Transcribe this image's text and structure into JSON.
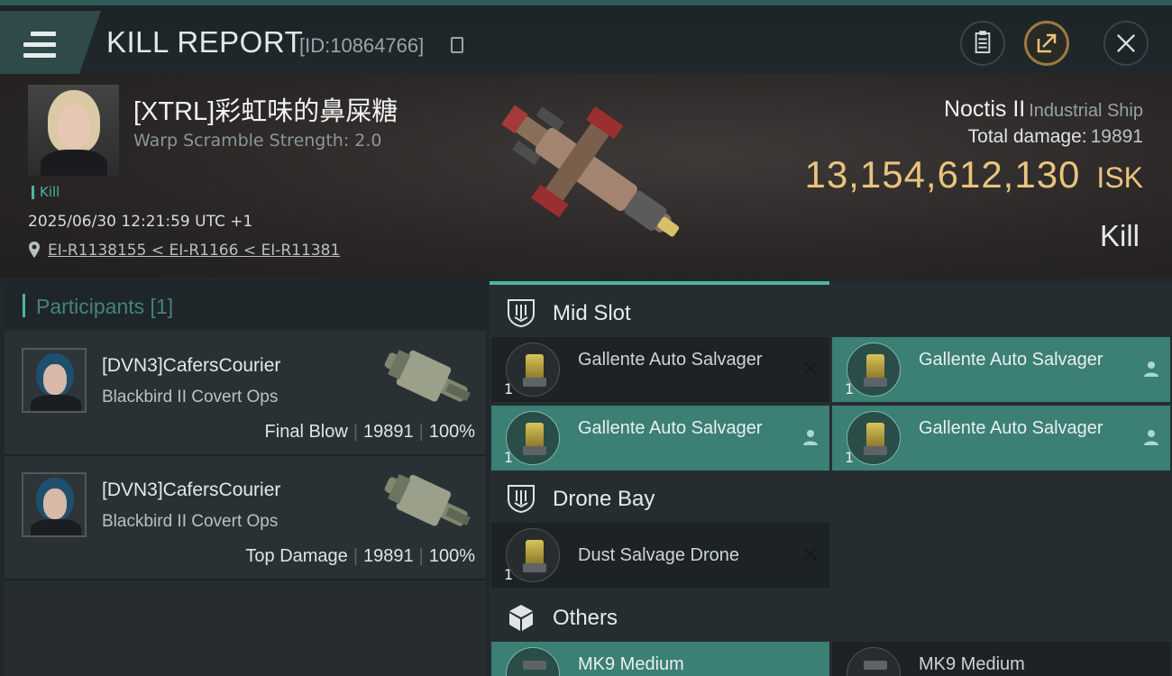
{
  "header": {
    "title": "KILL REPORT",
    "report_id": "[ID:10864766]"
  },
  "victim": {
    "name": "[XTRL]彩虹味的鼻屎糖",
    "warp_scramble": "Warp Scramble Strength: 2.0",
    "kill_tag": "Kill",
    "datetime": "2025/06/30 12:21:59 UTC +1",
    "location": "EI-R1138155 < EI-R1166 < EI-R11381",
    "ship_name": "Noctis II",
    "ship_class": "Industrial Ship",
    "total_damage_label": "Total damage:",
    "total_damage": "19891",
    "isk_value": "13,154,612,130",
    "isk_unit": "ISK",
    "result": "Kill"
  },
  "participants": {
    "title": "Participants [1]",
    "rows": [
      {
        "name": "[DVN3]CafersCourier",
        "ship": "Blackbird II Covert Ops",
        "role": "Final Blow",
        "damage": "19891",
        "percent": "100%"
      },
      {
        "name": "[DVN3]CafersCourier",
        "ship": "Blackbird II Covert Ops",
        "role": "Top Damage",
        "damage": "19891",
        "percent": "100%"
      }
    ]
  },
  "sections": {
    "mid_slot": "Mid Slot",
    "drone_bay": "Drone Bay",
    "others": "Others"
  },
  "mid_slot_items": [
    {
      "name": "Gallente Auto Salvager",
      "qty": "1",
      "status": "destroyed"
    },
    {
      "name": "Gallente Auto Salvager",
      "qty": "1",
      "status": "dropped"
    },
    {
      "name": "Gallente Auto Salvager",
      "qty": "1",
      "status": "dropped"
    },
    {
      "name": "Gallente Auto Salvager",
      "qty": "1",
      "status": "dropped"
    }
  ],
  "drone_bay_items": [
    {
      "name": "Dust Salvage Drone",
      "qty": "1",
      "status": "destroyed"
    }
  ],
  "others_items": [
    {
      "name": "MK9 Medium"
    },
    {
      "name": "MK9 Medium"
    }
  ],
  "colors": {
    "accent": "#4fb3a4",
    "isk_gold": "#e9c47f",
    "dropped_bg": "#3b7f75",
    "destroyed_bg": "#1d2225"
  }
}
